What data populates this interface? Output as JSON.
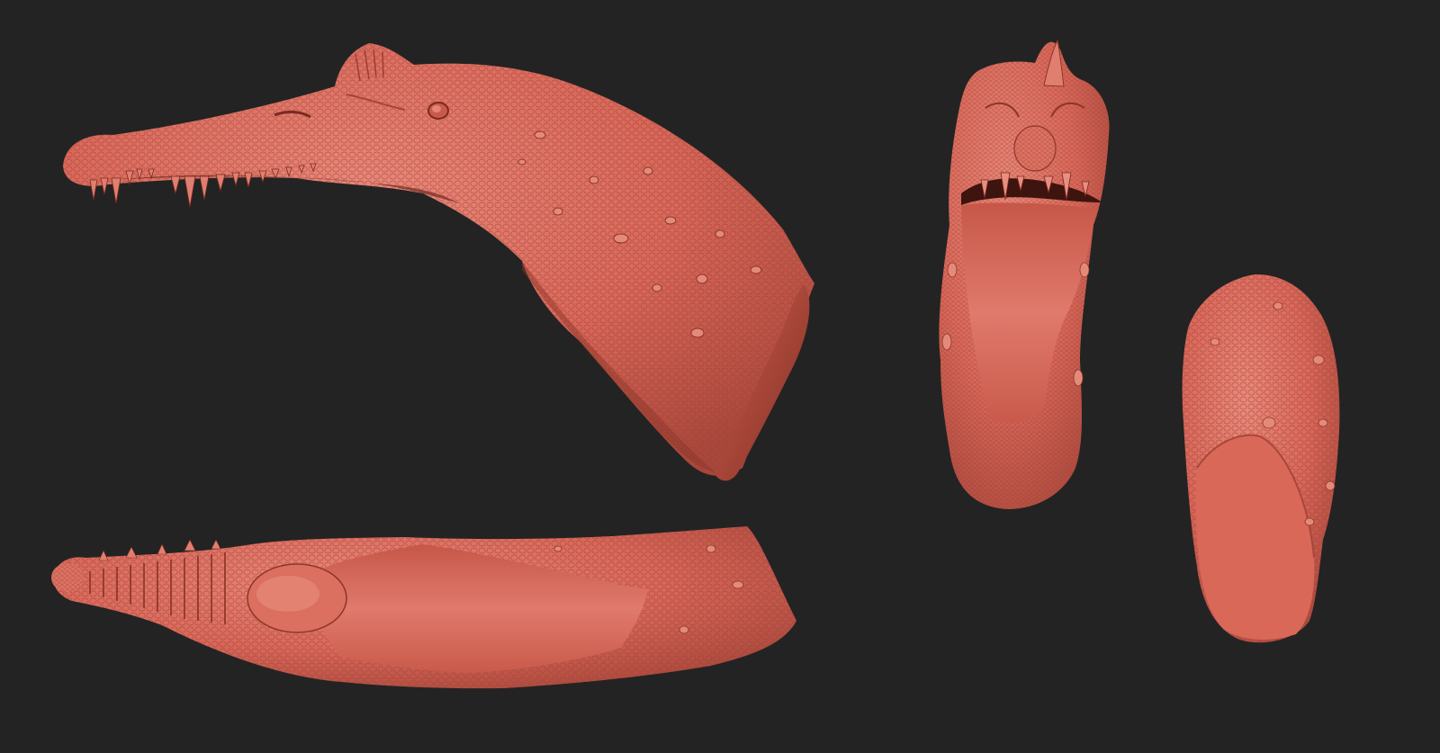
{
  "canvas": {
    "background": "#232323"
  },
  "model": {
    "clay_color": "#D9685A",
    "clay_highlight": "#E98A7C",
    "clay_shadow": "#8E3529",
    "cut_face_color": "#C9584A",
    "cut_face_dark": "#7E2C22"
  },
  "views": [
    {
      "id": "side-view",
      "icon": "spinosaurus-head-side-icon"
    },
    {
      "id": "front-view",
      "icon": "spinosaurus-head-front-icon"
    },
    {
      "id": "bottom-view",
      "icon": "spinosaurus-head-bottom-icon"
    },
    {
      "id": "back-view",
      "icon": "spinosaurus-head-back-icon"
    }
  ]
}
